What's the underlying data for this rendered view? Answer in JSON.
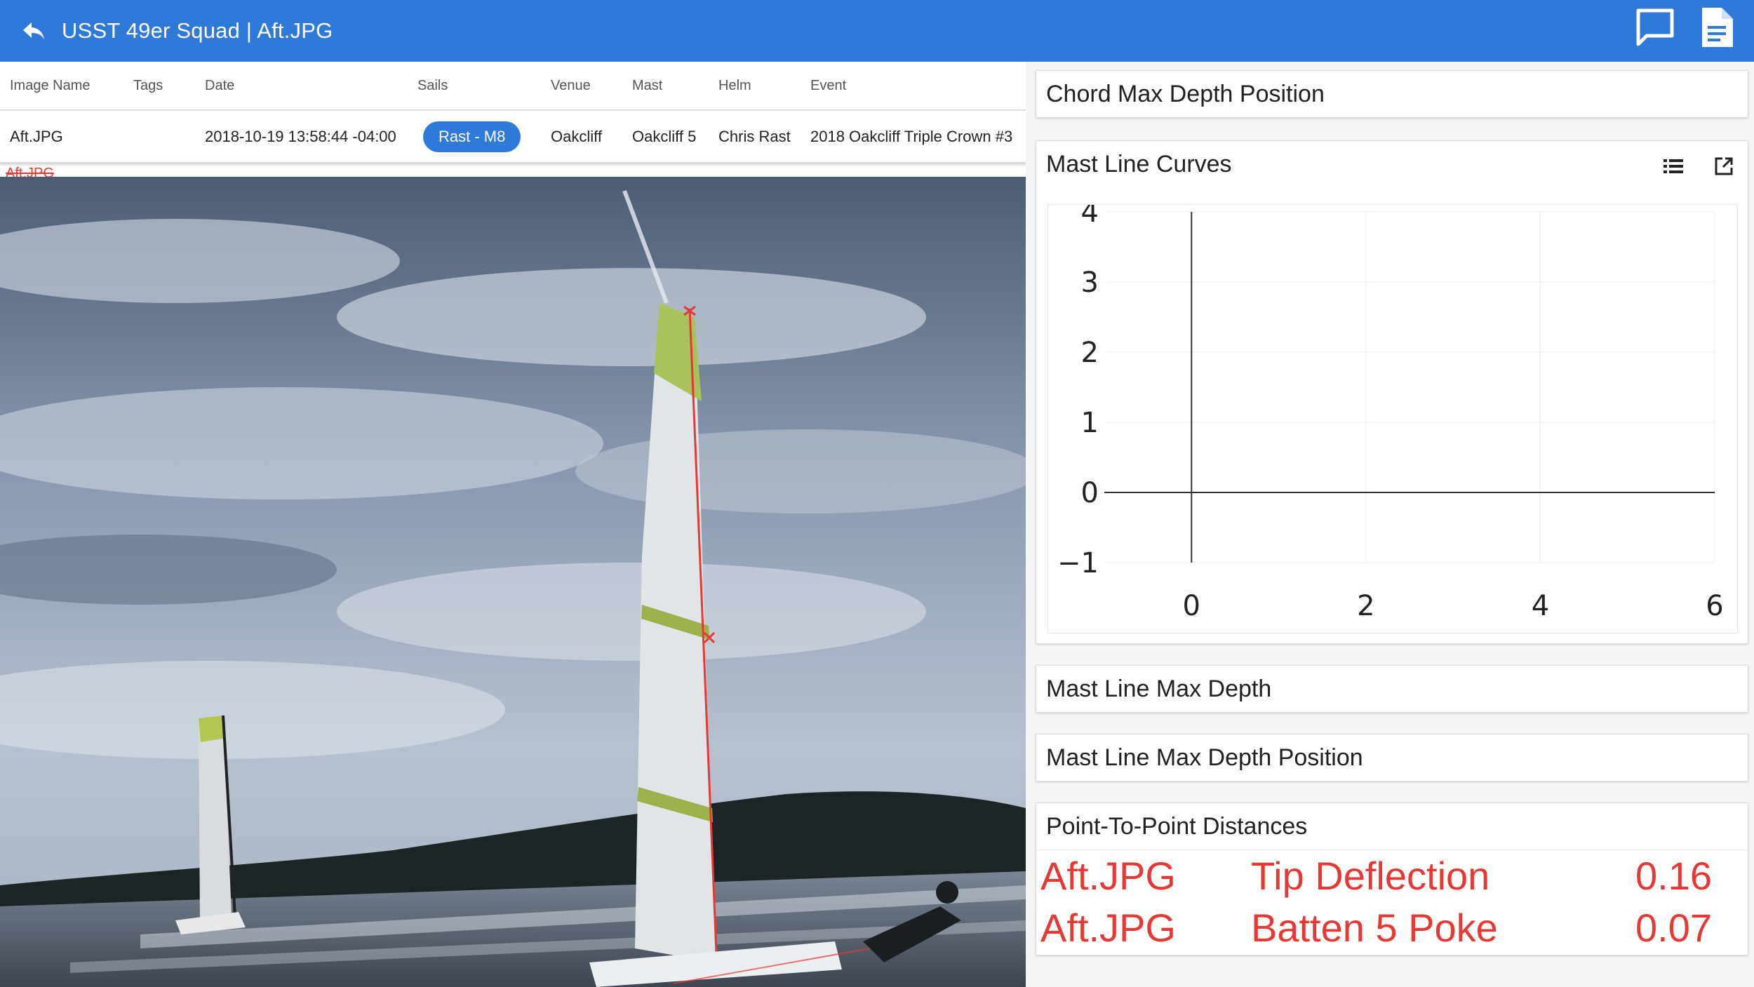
{
  "appbar": {
    "title": "USST 49er Squad | Aft.JPG",
    "back_icon": "back-arrow-icon",
    "comment_icon": "comment-icon",
    "document_icon": "document-icon"
  },
  "table": {
    "headers": [
      "Image Name",
      "Tags",
      "Date",
      "Sails",
      "Venue",
      "Mast",
      "Helm",
      "Event"
    ],
    "row": {
      "image_name": "Aft.JPG",
      "tags": "",
      "date": "2018-10-19 13:58:44 -04:00",
      "sails": "Rast - M8",
      "venue": "Oakcliff",
      "mast": "Oakcliff 5",
      "helm": "Chris Rast",
      "event": "2018 Oakcliff Triple Crown #3"
    }
  },
  "image_label": "Aft.JPG",
  "panels": {
    "chord_max_depth_position": "Chord Max Depth Position",
    "mast_line_curves": "Mast Line Curves",
    "mast_line_max_depth": "Mast Line Max Depth",
    "mast_line_max_depth_position": "Mast Line Max Depth Position",
    "point_to_point_distances": "Point-To-Point Distances"
  },
  "chart_data": {
    "type": "line",
    "title": "",
    "xlabel": "",
    "ylabel": "",
    "xlim": [
      -1,
      6
    ],
    "ylim": [
      -1,
      4
    ],
    "x_ticks": [
      "0",
      "2",
      "4",
      "6"
    ],
    "y_ticks": [
      "4",
      "3",
      "2",
      "1",
      "0",
      "−1"
    ],
    "series": [],
    "grid": true
  },
  "distances": [
    {
      "image": "Aft.JPG",
      "measure": "Tip Deflection",
      "value": "0.16"
    },
    {
      "image": "Aft.JPG",
      "measure": "Batten 5 Poke",
      "value": "0.07"
    }
  ],
  "colors": {
    "appbar": "#2f7ad8",
    "accent_red": "#e53935",
    "chip": "#2f7ad8"
  }
}
